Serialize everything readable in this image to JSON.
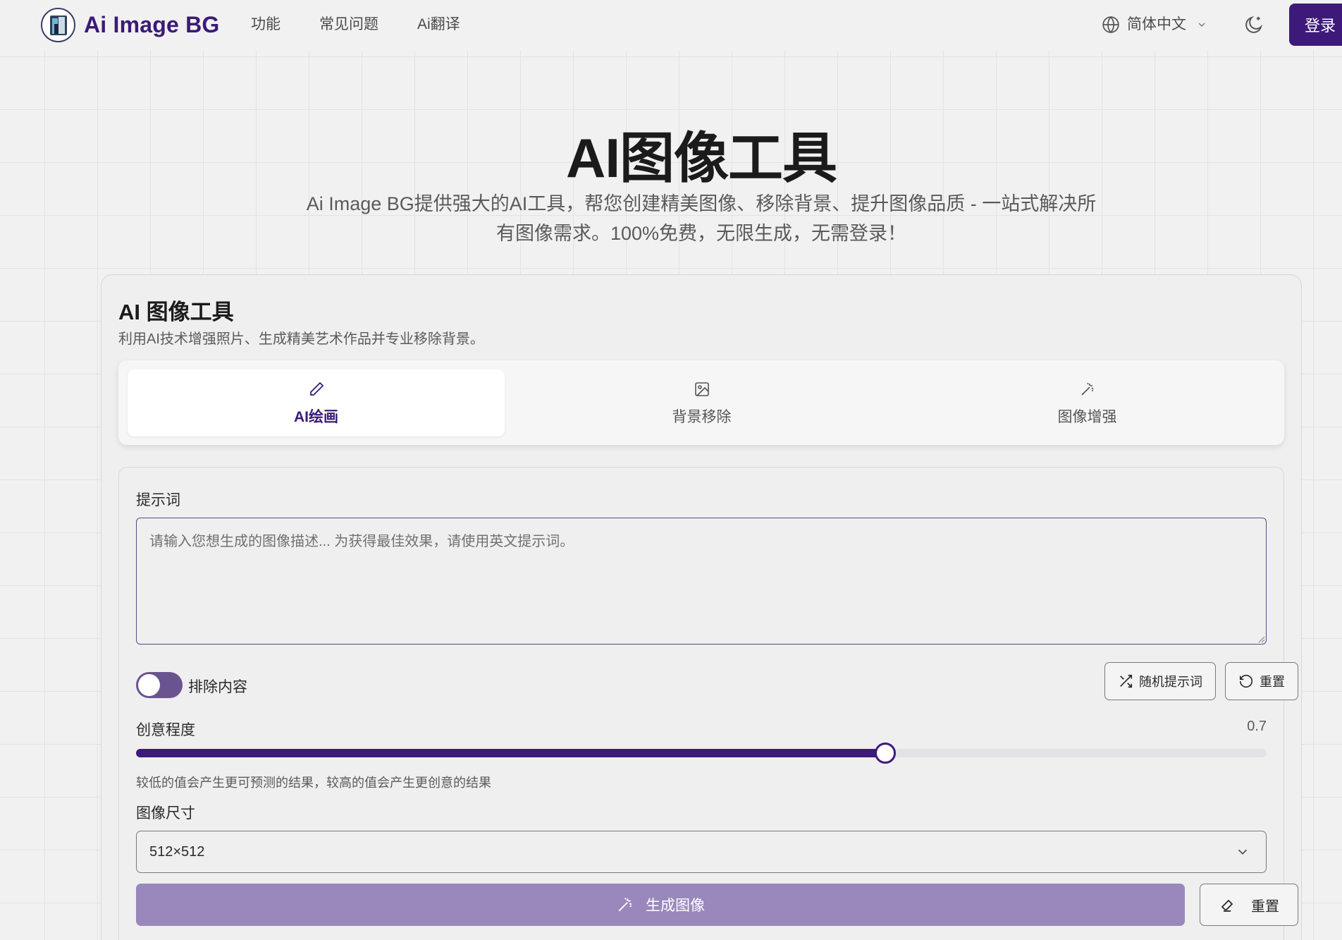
{
  "header": {
    "brand": "Ai Image BG",
    "nav": [
      "功能",
      "常见问题",
      "Ai翻译"
    ],
    "language": "简体中文",
    "login": "登录"
  },
  "hero": {
    "title": "AI图像工具",
    "subtitle": "Ai Image BG提供强大的AI工具，帮您创建精美图像、移除背景、提升图像品质 - 一站式解决所有图像需求。100%免费，无限生成，无需登录！"
  },
  "card": {
    "title": "AI 图像工具",
    "description": "利用AI技术增强照片、生成精美艺术作品并专业移除背景。",
    "tabs": [
      {
        "label": "AI绘画",
        "icon": "pencil-icon",
        "active": true
      },
      {
        "label": "背景移除",
        "icon": "image-icon",
        "active": false
      },
      {
        "label": "图像增强",
        "icon": "magic-wand-icon",
        "active": false
      }
    ]
  },
  "form": {
    "prompt_label": "提示词",
    "prompt_placeholder": "请输入您想生成的图像描述... 为获得最佳效果，请使用英文提示词。",
    "prompt_value": "",
    "exclude_label": "排除内容",
    "exclude_enabled": false,
    "random_prompt_label": "随机提示词",
    "reset_label": "重置",
    "creativity_label": "创意程度",
    "creativity_value": "0.7",
    "creativity_level": 0.663,
    "creativity_hint": "较低的值会产生更可预测的结果，较高的值会产生更创意的结果",
    "size_label": "图像尺寸",
    "size_value": "512×512",
    "generate_label": "生成图像",
    "clear_label": "重置"
  },
  "colors": {
    "brand": "#3a1a78",
    "primary": "#3d1a7a",
    "primary_disabled": "#9a88bc",
    "toggle": "#6a548f"
  }
}
